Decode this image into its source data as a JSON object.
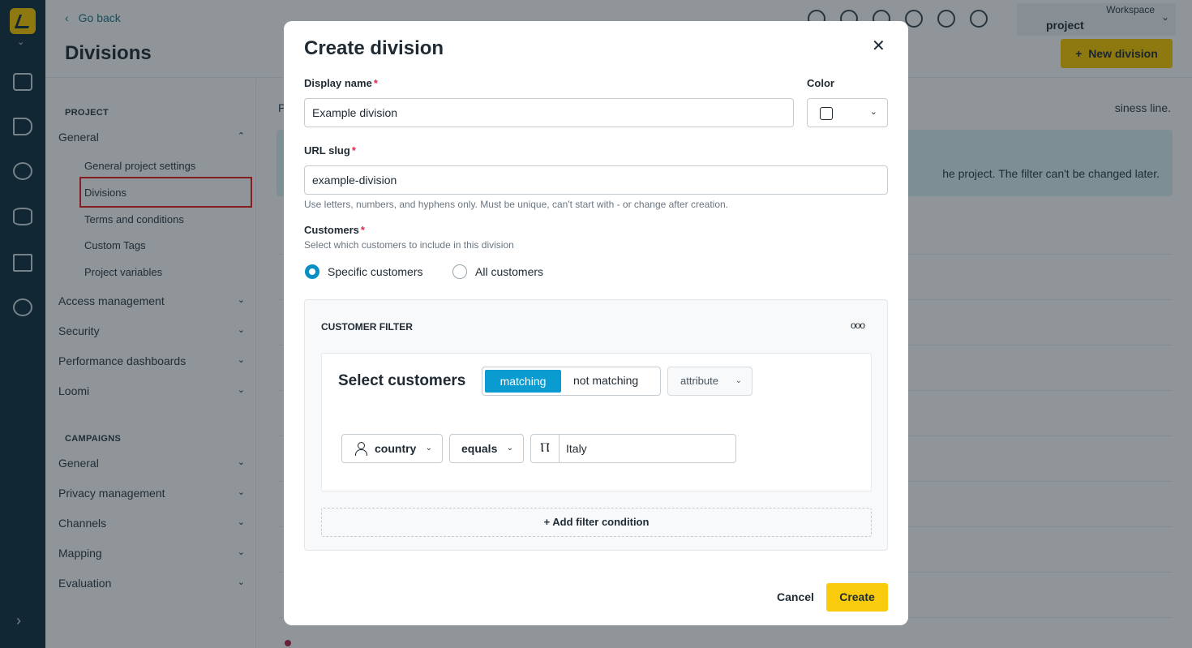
{
  "header": {
    "go_back": "Go back",
    "page_title": "Divisions",
    "workspace_label": "Workspace",
    "project_name": "project",
    "new_division": "New division"
  },
  "sidebar": {
    "project_label": "PROJECT",
    "general": "General",
    "sub_items": [
      "General project settings",
      "Divisions",
      "Terms and conditions",
      "Custom Tags",
      "Project variables"
    ],
    "project_groups": [
      "Access management",
      "Security",
      "Performance dashboards",
      "Loomi"
    ],
    "campaigns_label": "CAMPAIGNS",
    "campaign_groups": [
      "General",
      "Privacy management",
      "Channels",
      "Mapping",
      "Evaluation"
    ]
  },
  "background": {
    "text_left": "P",
    "text_right": "siness line.",
    "info_text": "he project. The filter can't be changed later."
  },
  "modal": {
    "title": "Create division",
    "display_name_label": "Display name",
    "display_name_value": "Example division",
    "color_label": "Color",
    "url_slug_label": "URL slug",
    "url_slug_value": "example-division",
    "url_slug_hint": "Use letters, numbers, and hyphens only. Must be unique, can't start with - or change after creation.",
    "customers_label": "Customers",
    "customers_hint": "Select which customers to include in this division",
    "radio_specific": "Specific customers",
    "radio_all": "All customers",
    "filter_header": "CUSTOMER FILTER",
    "select_customers": "Select customers",
    "matching": "matching",
    "not_matching": "not matching",
    "attribute": "attribute",
    "condition_property": "country",
    "condition_operator": "equals",
    "condition_value": "Italy",
    "add_condition": "+ Add filter condition",
    "cancel": "Cancel",
    "create": "Create"
  },
  "colors": {
    "accent_yellow": "#f2c300",
    "accent_blue": "#0a9bd0",
    "nav_dark": "#0f2f3e",
    "required": "#e0284f"
  }
}
